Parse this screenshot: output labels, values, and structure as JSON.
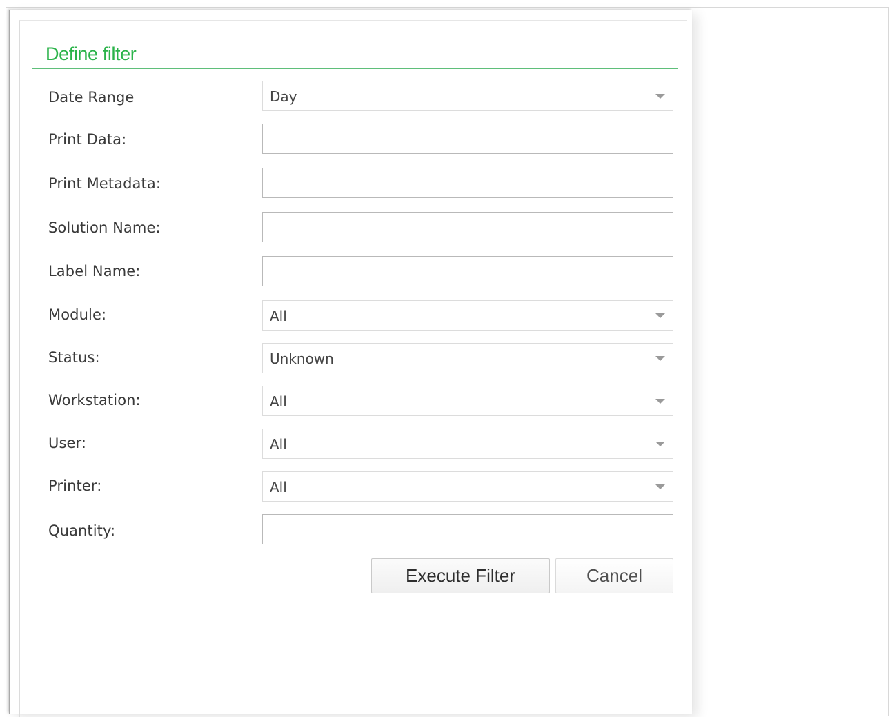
{
  "dialog": {
    "title": "Define filter"
  },
  "form": {
    "date_range": {
      "label": "Date Range",
      "value": "Day"
    },
    "print_data": {
      "label": "Print Data:",
      "value": ""
    },
    "print_metadata": {
      "label": "Print Metadata:",
      "value": ""
    },
    "solution_name": {
      "label": "Solution Name:",
      "value": ""
    },
    "label_name": {
      "label": "Label Name:",
      "value": ""
    },
    "module": {
      "label": "Module:",
      "value": "All"
    },
    "status": {
      "label": "Status:",
      "value": "Unknown"
    },
    "workstation": {
      "label": "Workstation:",
      "value": "All"
    },
    "user": {
      "label": "User:",
      "value": "All"
    },
    "printer": {
      "label": "Printer:",
      "value": "All"
    },
    "quantity": {
      "label": "Quantity:",
      "value": ""
    }
  },
  "buttons": {
    "execute_label": "Execute Filter",
    "cancel_label": "Cancel"
  },
  "icons": {
    "dropdown": "chevron-down-icon"
  },
  "colors": {
    "title": "#2bb34a",
    "title_rule": "#5fbf7a",
    "label_text": "#3a3a3a",
    "field_border": "#b9b9b9"
  }
}
